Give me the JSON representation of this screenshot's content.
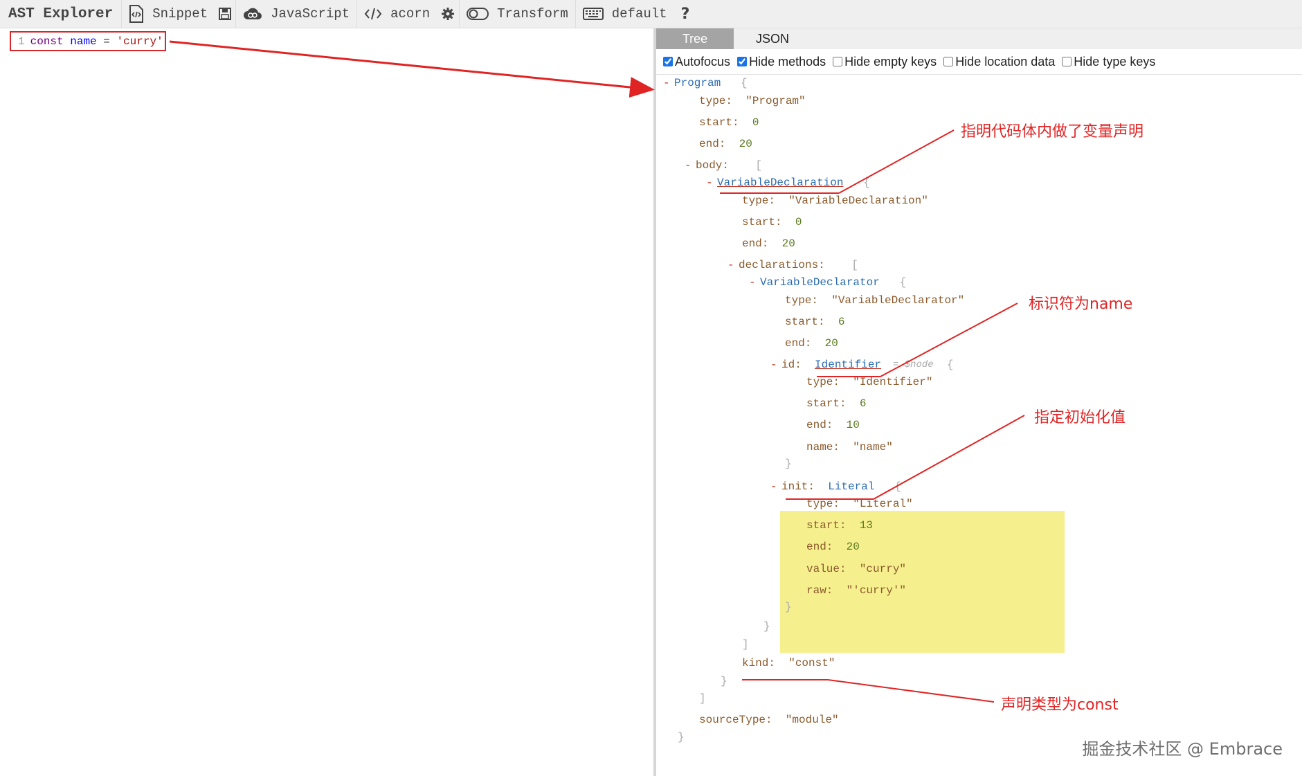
{
  "toolbar": {
    "brand": "AST Explorer",
    "snippet": "Snippet",
    "language": "JavaScript",
    "parser": "acorn",
    "transform": "Transform",
    "keymap": "default",
    "help": "?"
  },
  "editor": {
    "line_number": "1",
    "kw": "const",
    "var": "name",
    "op": " = ",
    "str": "'curry'"
  },
  "tabs": [
    "Tree",
    "JSON"
  ],
  "options": [
    {
      "label": "Autofocus",
      "checked": true
    },
    {
      "label": "Hide methods",
      "checked": true
    },
    {
      "label": "Hide empty keys",
      "checked": false
    },
    {
      "label": "Hide location data",
      "checked": false
    },
    {
      "label": "Hide type keys",
      "checked": false
    }
  ],
  "tree": {
    "program": "Program",
    "program_type": "\"Program\"",
    "program_start": "0",
    "program_end": "20",
    "body_key": "body:",
    "var_decl": "VariableDeclaration",
    "var_decl_type": "\"VariableDeclaration\"",
    "var_decl_start": "0",
    "var_decl_end": "20",
    "declarations_key": "declarations:",
    "declarator": "VariableDeclarator",
    "declarator_type": "\"VariableDeclarator\"",
    "declarator_start": "6",
    "declarator_end": "20",
    "id_key": "id:",
    "identifier": "Identifier",
    "node_meta": "$node",
    "identifier_type": "\"Identifier\"",
    "identifier_start": "6",
    "identifier_end": "10",
    "identifier_name": "\"name\"",
    "init_key": "init:",
    "literal": "Literal",
    "literal_type": "\"Literal\"",
    "literal_start": "13",
    "literal_end": "20",
    "literal_value": "\"curry\"",
    "literal_raw": "\"'curry'\"",
    "kind_key": "kind:",
    "kind_value": "\"const\"",
    "source_type_key": "sourceType:",
    "source_type_value": "\"module\""
  },
  "annotations": {
    "declaration_note": "指明代码体内做了变量声明",
    "identifier_note": "标识符为name",
    "init_note": "指定初始化值",
    "kind_note": "声明类型为const"
  },
  "watermark": "掘金技术社区 @ Embrace",
  "colors": {
    "annotation": "#e02424",
    "highlight": "#f5ef8e",
    "active_tab": "#a4a4a4"
  }
}
